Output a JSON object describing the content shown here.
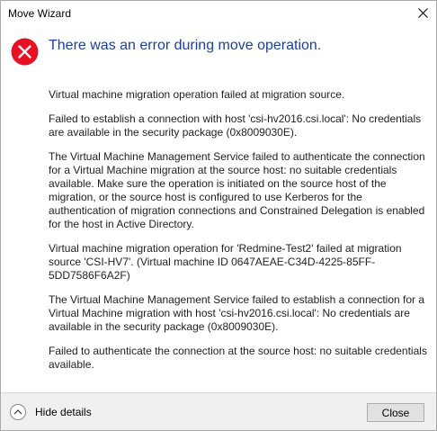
{
  "window": {
    "title": "Move Wizard"
  },
  "error": {
    "icon": "error-circle-icon",
    "color": "#e81123",
    "headline": "There was an error during move operation."
  },
  "details": [
    "Virtual machine migration operation failed at migration source.",
    "Failed to establish a connection with host 'csi-hv2016.csi.local': No credentials are available in the security package (0x8009030E).",
    "The Virtual Machine Management Service failed to authenticate the connection for a Virtual Machine migration at the source host: no suitable credentials available. Make sure the operation is initiated on the source host of the migration, or the source host is configured to use Kerberos for the authentication of migration connections and Constrained Delegation is enabled for the host in Active Directory.",
    "Virtual machine migration operation for 'Redmine-Test2' failed at migration source 'CSI-HV7'. (Virtual machine ID 0647AEAE-C34D-4225-85FF-5DD7586F6A2F)",
    "The Virtual Machine Management Service failed to establish a connection for a Virtual Machine migration with host 'csi-hv2016.csi.local': No credentials are available in the security package (0x8009030E).",
    "Failed to authenticate the connection at the source host: no suitable credentials available."
  ],
  "footer": {
    "hide_details_label": "Hide details",
    "close_label": "Close"
  }
}
